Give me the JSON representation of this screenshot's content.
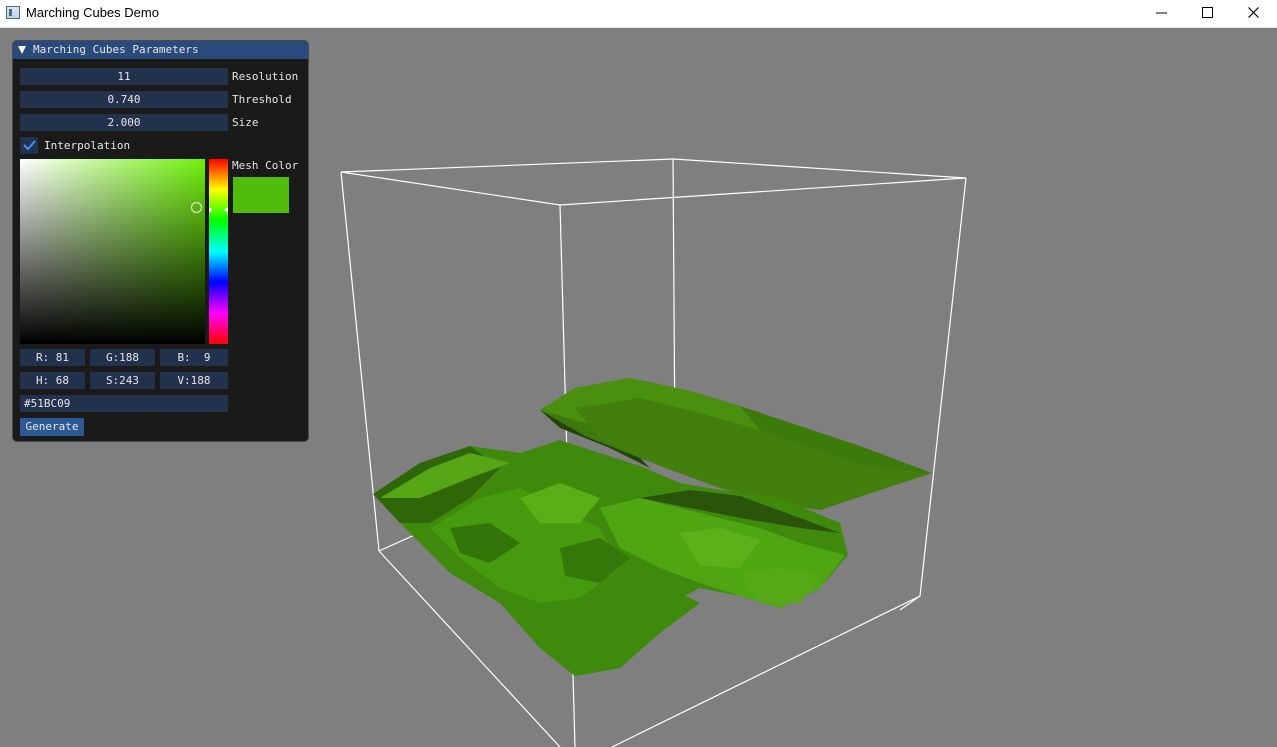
{
  "window": {
    "title": "Marching Cubes Demo",
    "minimize_icon": "minimize-icon",
    "maximize_icon": "maximize-icon",
    "close_icon": "close-icon"
  },
  "panel": {
    "title": "Marching Cubes Parameters",
    "resolution": {
      "value": "11",
      "label": "Resolution"
    },
    "threshold": {
      "value": "0.740",
      "label": "Threshold"
    },
    "size": {
      "value": "2.000",
      "label": "Size"
    },
    "interpolation": {
      "label": "Interpolation",
      "checked": true
    },
    "mesh_color": {
      "label": "Mesh Color",
      "swatch": "#51BC09",
      "r": "R: 81",
      "g": "G:188",
      "b": "B:  9",
      "h": "H: 68",
      "s": "S:243",
      "v": "V:188",
      "hex": "#51BC09"
    },
    "generate_label": "Generate"
  },
  "colors": {
    "viewport_bg": "#7f7f7f",
    "panel_bg": "#141414",
    "panel_header": "#2a4a7c",
    "field_bg": "#23324c",
    "button_bg": "#2d5893",
    "mesh": "#4fa30b",
    "wireframe": "#ffffff"
  }
}
